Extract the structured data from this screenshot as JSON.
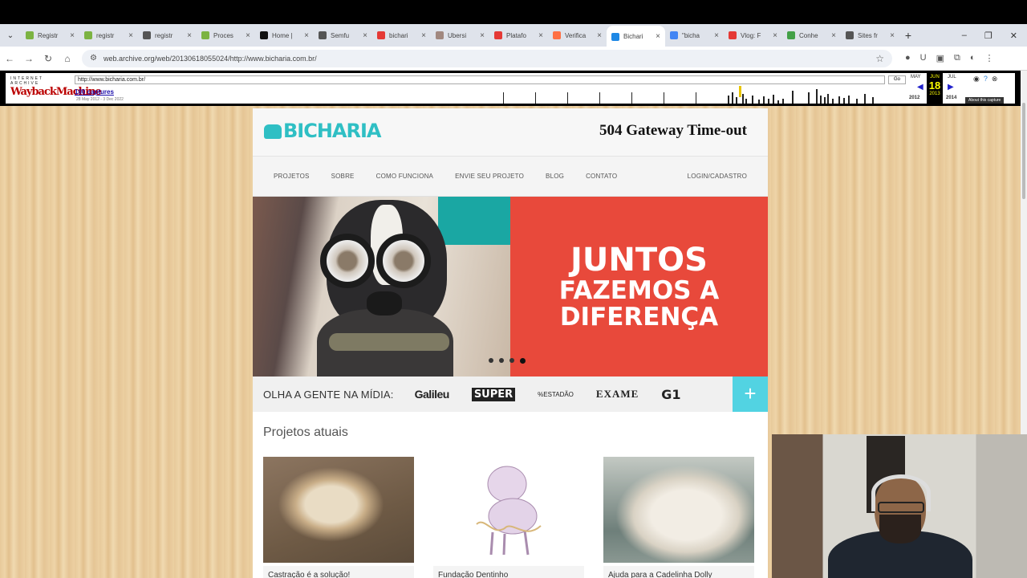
{
  "browser": {
    "tabs": [
      {
        "label": "Registr",
        "color": "#7cb342"
      },
      {
        "label": "registr",
        "color": "#7cb342"
      },
      {
        "label": "registr",
        "color": "#555555"
      },
      {
        "label": "Proces",
        "color": "#7cb342"
      },
      {
        "label": "Home |",
        "color": "#111111"
      },
      {
        "label": "Semfu",
        "color": "#555555"
      },
      {
        "label": "bichari",
        "color": "#e53935"
      },
      {
        "label": "Ubersi",
        "color": "#a1887f"
      },
      {
        "label": "Platafo",
        "color": "#e53935"
      },
      {
        "label": "Verifica",
        "color": "#ff7043"
      },
      {
        "label": "Bichari",
        "color": "#1e88e5",
        "active": true
      },
      {
        "label": "\"bicha",
        "color": "#4285f4"
      },
      {
        "label": "Vlog: F",
        "color": "#e53935"
      },
      {
        "label": "Conhe",
        "color": "#43a047"
      },
      {
        "label": "Sites fr",
        "color": "#555555"
      }
    ],
    "tab_close": "×",
    "new_tab": "+",
    "url": "web.archive.org/web/20130618055024/http://www.bicharia.com.br/"
  },
  "wayback": {
    "ia_label": "INTERNET ARCHIVE",
    "logo_text": "WaybackMachine",
    "url_input": "http://www.bicharia.com.br/",
    "go": "Go",
    "captures": "100 captures",
    "range": "28 May 2012 - 3 Dec 2022",
    "cal_prev_month": "MAY",
    "cal_month": "JUN",
    "cal_day": "18",
    "cal_year": "2013",
    "cal_next_month": "JUL",
    "cal_prev_year": "2012",
    "cal_next_year": "2014",
    "about": "About this capture"
  },
  "site": {
    "logo": "BICHARIA",
    "error": "504 Gateway Time-out",
    "nav": [
      "PROJETOS",
      "SOBRE",
      "COMO FUNCIONA",
      "ENVIE SEU PROJETO",
      "BLOG",
      "CONTATO"
    ],
    "login": "LOGIN/CADASTRO",
    "banner": {
      "line1": "JUNTOS",
      "line2": "FAZEMOS A",
      "line3": "DIFERENÇA",
      "slides": 4,
      "active_slide": 4
    },
    "media_label": "OLHA A GENTE NA MÍDIA:",
    "media_logos": [
      "Galileu",
      "SUPER",
      "%ESTADÃO",
      "EXAME",
      "G1"
    ],
    "plus": "+",
    "projects_title": "Projetos atuais",
    "projects": [
      {
        "caption": "Castração é a solução!"
      },
      {
        "caption": "Fundação Dentinho"
      },
      {
        "caption": "Ajuda para a Cadelinha Dolly"
      }
    ]
  }
}
